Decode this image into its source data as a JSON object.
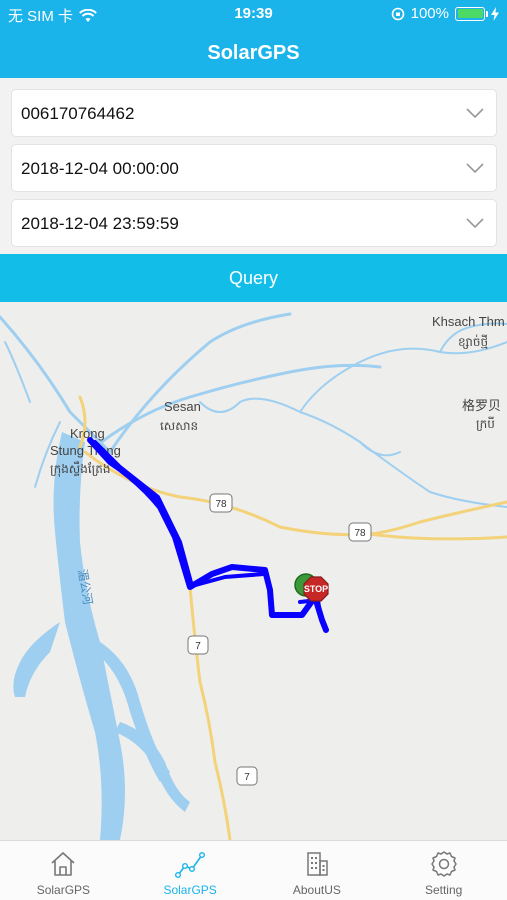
{
  "status_bar": {
    "carrier": "无 SIM 卡",
    "time": "19:39",
    "battery": "100%"
  },
  "nav": {
    "title": "SolarGPS"
  },
  "form": {
    "device_id": "006170764462",
    "start_time": "2018-12-04 00:00:00",
    "end_time": "2018-12-04 23:59:59",
    "query_label": "Query"
  },
  "map": {
    "labels": {
      "krong": "Krong",
      "stung_treng": "Stung Treng",
      "stung_treng_khmer": "ក្រុងស្ទឹងត្រែង",
      "sesan": "Sesan",
      "sesan_khmer": "សេសាន",
      "khsach": "Khsach Thm",
      "khsach_khmer": "ខ្សាច់ថ្មី",
      "gelaobei": "格罗贝",
      "gelaobei_khmer": "ក្របី",
      "river_name": "湄公河",
      "route_78a": "78",
      "route_78b": "78",
      "route_7a": "7",
      "route_7b": "7",
      "stop_marker": "STOP"
    },
    "colors": {
      "track": "#0a00ff",
      "river": "#9ecff0",
      "road": "#f3d27a",
      "background": "#eeeeec"
    }
  },
  "tabs": [
    {
      "label": "SolarGPS",
      "icon": "home-icon"
    },
    {
      "label": "SolarGPS",
      "icon": "track-chart-icon"
    },
    {
      "label": "AboutUS",
      "icon": "building-icon"
    },
    {
      "label": "Setting",
      "icon": "gear-icon"
    }
  ],
  "active_tab": 1
}
